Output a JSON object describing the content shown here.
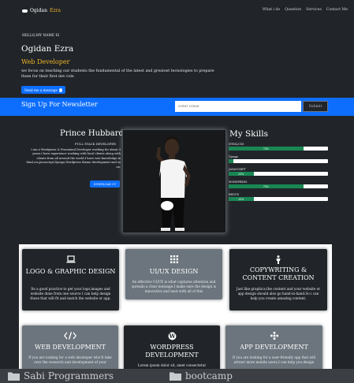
{
  "nav": {
    "brand_first": "Ogidan",
    "brand_second": "Ezra",
    "links": [
      "What i do",
      "Question",
      "Services",
      "Contact Me"
    ]
  },
  "hero": {
    "greeting": "HELLO,MY NAME IS",
    "name": "Ogidan Ezra",
    "role": "Web Developer",
    "description": "we focus on teaching our students the fundamental of the latest and greatest tecnologies to prepare them for their first dev role",
    "button_label": "Send me a message"
  },
  "newsletter": {
    "title": "Sign Up For Newsletter",
    "placeholder": "Enter Email",
    "submit_label": "Submit"
  },
  "about": {
    "name": "Prince Hubbard",
    "title": "FULL STACK DEVELOPER",
    "description": "I am a Wordpress & Froontend Developer working for about 3 years.I have experience working with local clients along with clients from all around the world.I have vast knowledge in html,css,Javascript,Django,Wordpress theme development and so on.",
    "button_label": "DOWNLOAD CV"
  },
  "skills": {
    "title": "My Skills",
    "items": [
      {
        "label": "HTML/CSS",
        "percent": 75,
        "text": "75%"
      },
      {
        "label": "Django",
        "percent": 5,
        "text": ""
      },
      {
        "label": "JAVASCRIPT",
        "percent": 25,
        "text": "25%"
      },
      {
        "label": "WORDPRESS",
        "percent": 75,
        "text": "75%"
      },
      {
        "label": "REDUX",
        "percent": 25,
        "text": "25%"
      }
    ]
  },
  "services": [
    {
      "title": "LOGO & GRAPHIC DESIGN",
      "desc": "Its a good practice to get your logo,images and website done from one source I can help design those that will fit and match the website or app.",
      "icon": "laptop-icon",
      "style": "dark"
    },
    {
      "title": "UI/UX DESIGN",
      "desc": "An effective UI/UX is what captures attention and spreads a clear message.I make sure the design is innovative and neat with all of this",
      "icon": "grid-icon",
      "style": "gray"
    },
    {
      "title": "COPYWRITING & CONTENT CREATION",
      "desc": "Just like graphics,the content and your website or app design should also go hand-in-hand.So i can help you create amazing content.",
      "icon": "person-icon",
      "style": "dark"
    },
    {
      "title": "WEB DEVELOPMENT",
      "desc": "If you are looking for a web developer who'll take over the research and development of your",
      "icon": "code-icon",
      "style": "gray"
    },
    {
      "title": "WORDPRESS DEVELOPMENT",
      "desc": "Lorem ipsum dolor sit, amet consectetur",
      "icon": "wordpress-icon",
      "style": "dark"
    },
    {
      "title": "APP DEVELOPMENT",
      "desc": "If you are looking for a user-friendly app that will attract more mobile users.I can help you design",
      "icon": "apps-icon",
      "style": "gray"
    }
  ],
  "bottombar": {
    "folder1": "Sabi Programmers",
    "folder2": "bootcamp"
  },
  "colors": {
    "primary": "#0d6efd",
    "dark": "#212529",
    "gray": "#6c757d",
    "accent": "#f0b429",
    "success": "#198754"
  }
}
